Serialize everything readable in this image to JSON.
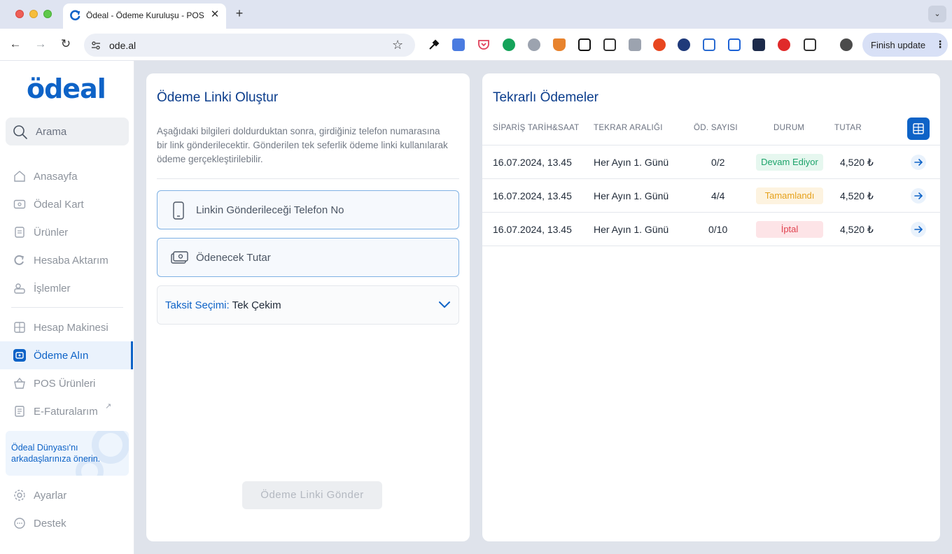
{
  "browser": {
    "tab_title": "Ödeal - Ödeme Kuruluşu - POS",
    "url": "ode.al",
    "finish_update_label": "Finish update",
    "extensions": [
      "eyedropper-icon",
      "translate-icon",
      "pocket-icon",
      "grammarly-icon",
      "gear-extension-icon",
      "metamask-icon",
      "notion-icon",
      "screenshot-icon",
      "camera-icon",
      "plus-circle-icon",
      "globe-icon",
      "window-capture-icon",
      "crop-icon",
      "video-icon",
      "pinterest-icon",
      "puzzle-icon"
    ]
  },
  "sidebar": {
    "logo": "ödeal",
    "search_placeholder": "Arama",
    "items": [
      {
        "label": "Anasayfa",
        "icon": "home-icon"
      },
      {
        "label": "Ödeal Kart",
        "icon": "card-icon"
      },
      {
        "label": "Ürünler",
        "icon": "products-icon"
      },
      {
        "label": "Hesaba Aktarım",
        "icon": "transfer-icon"
      },
      {
        "label": "İşlemler",
        "icon": "transactions-icon"
      },
      {
        "label": "Hesap Makinesi",
        "icon": "calculator-icon"
      },
      {
        "label": "Ödeme Alın",
        "icon": "payment-icon",
        "active": true
      },
      {
        "label": "POS Ürünleri",
        "icon": "basket-icon"
      },
      {
        "label": "E-Faturalarım",
        "icon": "invoice-icon"
      }
    ],
    "promo_text": "Ödeal Dünyası'nı arkadaşlarınıza önerin.",
    "settings_label": "Ayarlar",
    "support_label": "Destek"
  },
  "payment_link": {
    "title": "Ödeme Linki Oluştur",
    "description": "Aşağıdaki bilgileri doldurduktan sonra, girdiğiniz telefon numarasına bir link gönderilecektir. Gönderilen tek seferlik ödeme linki kullanılarak ödeme gerçekleştirilebilir.",
    "phone_placeholder": "Linkin Gönderileceği Telefon No",
    "amount_placeholder": "Ödenecek Tutar",
    "installment_label": "Taksit Seçimi:",
    "installment_value": "Tek Çekim",
    "send_button": "Ödeme Linki Gönder"
  },
  "recurring": {
    "title": "Tekrarlı Ödemeler",
    "columns": [
      "SİPARİŞ TARİH&SAAT",
      "TEKRAR ARALIĞI",
      "ÖD. SAYISI",
      "DURUM",
      "TUTAR"
    ],
    "rows": [
      {
        "date": "16.07.2024, 13.45",
        "interval": "Her Ayın 1. Günü",
        "count": "0/2",
        "status": "Devam Ediyor",
        "amount": "4,520 ₺"
      },
      {
        "date": "16.07.2024, 13.45",
        "interval": "Her Ayın 1. Günü",
        "count": "4/4",
        "status": "Tamamlandı",
        "amount": "4,520 ₺"
      },
      {
        "date": "16.07.2024, 13.45",
        "interval": "Her Ayın 1. Günü",
        "count": "0/10",
        "status": "İptal",
        "amount": "4,520 ₺"
      }
    ]
  },
  "colors": {
    "brand": "#0e63c7",
    "status_active": "#1ca36a",
    "status_completed": "#e6a11b",
    "status_cancelled": "#e0424f"
  }
}
